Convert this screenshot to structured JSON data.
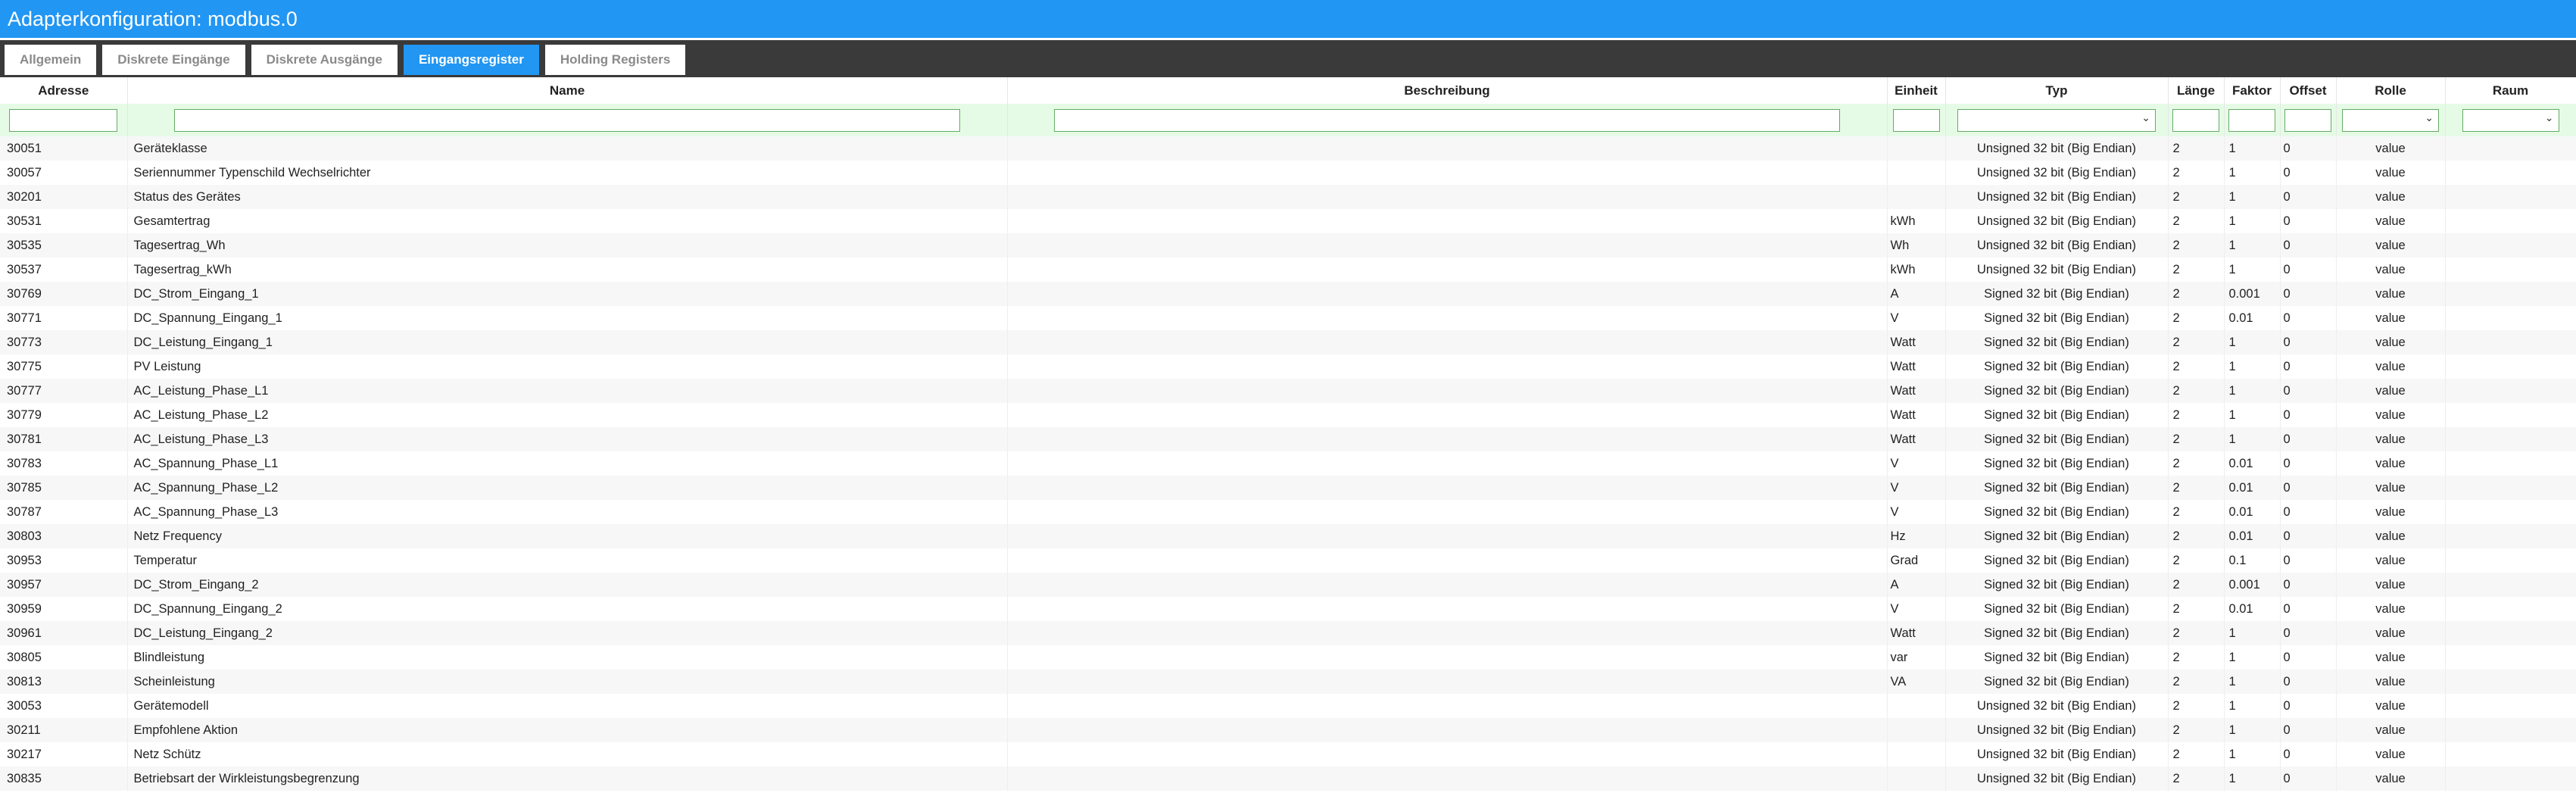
{
  "window": {
    "title": "Adapterkonfiguration: modbus.0"
  },
  "tabs": [
    {
      "label": "Allgemein",
      "active": false
    },
    {
      "label": "Diskrete Eingänge",
      "active": false
    },
    {
      "label": "Diskrete Ausgänge",
      "active": false
    },
    {
      "label": "Eingangsregister",
      "active": true
    },
    {
      "label": "Holding Registers",
      "active": false
    }
  ],
  "table": {
    "headers": {
      "address": "Adresse",
      "name": "Name",
      "description": "Beschreibung",
      "unit": "Einheit",
      "type": "Typ",
      "length": "Länge",
      "factor": "Faktor",
      "offset": "Offset",
      "role": "Rolle",
      "room": "Raum"
    },
    "rows": [
      {
        "address": "30051",
        "name": "Geräteklasse",
        "unit": "",
        "type": "Unsigned 32 bit (Big Endian)",
        "length": "2",
        "factor": "1",
        "offset": "0",
        "role": "value"
      },
      {
        "address": "30057",
        "name": "Seriennummer Typenschild Wechselrichter",
        "unit": "",
        "type": "Unsigned 32 bit (Big Endian)",
        "length": "2",
        "factor": "1",
        "offset": "0",
        "role": "value"
      },
      {
        "address": "30201",
        "name": "Status des Gerätes",
        "unit": "",
        "type": "Unsigned 32 bit (Big Endian)",
        "length": "2",
        "factor": "1",
        "offset": "0",
        "role": "value"
      },
      {
        "address": "30531",
        "name": "Gesamtertrag",
        "unit": "kWh",
        "type": "Unsigned 32 bit (Big Endian)",
        "length": "2",
        "factor": "1",
        "offset": "0",
        "role": "value"
      },
      {
        "address": "30535",
        "name": "Tagesertrag_Wh",
        "unit": "Wh",
        "type": "Unsigned 32 bit (Big Endian)",
        "length": "2",
        "factor": "1",
        "offset": "0",
        "role": "value"
      },
      {
        "address": "30537",
        "name": "Tagesertrag_kWh",
        "unit": "kWh",
        "type": "Unsigned 32 bit (Big Endian)",
        "length": "2",
        "factor": "1",
        "offset": "0",
        "role": "value"
      },
      {
        "address": "30769",
        "name": "DC_Strom_Eingang_1",
        "unit": "A",
        "type": "Signed 32 bit (Big Endian)",
        "length": "2",
        "factor": "0.001",
        "offset": "0",
        "role": "value"
      },
      {
        "address": "30771",
        "name": "DC_Spannung_Eingang_1",
        "unit": "V",
        "type": "Signed 32 bit (Big Endian)",
        "length": "2",
        "factor": "0.01",
        "offset": "0",
        "role": "value"
      },
      {
        "address": "30773",
        "name": "DC_Leistung_Eingang_1",
        "unit": "Watt",
        "type": "Signed 32 bit (Big Endian)",
        "length": "2",
        "factor": "1",
        "offset": "0",
        "role": "value"
      },
      {
        "address": "30775",
        "name": "PV Leistung",
        "unit": "Watt",
        "type": "Signed 32 bit (Big Endian)",
        "length": "2",
        "factor": "1",
        "offset": "0",
        "role": "value"
      },
      {
        "address": "30777",
        "name": "AC_Leistung_Phase_L1",
        "unit": "Watt",
        "type": "Signed 32 bit (Big Endian)",
        "length": "2",
        "factor": "1",
        "offset": "0",
        "role": "value"
      },
      {
        "address": "30779",
        "name": "AC_Leistung_Phase_L2",
        "unit": "Watt",
        "type": "Signed 32 bit (Big Endian)",
        "length": "2",
        "factor": "1",
        "offset": "0",
        "role": "value"
      },
      {
        "address": "30781",
        "name": "AC_Leistung_Phase_L3",
        "unit": "Watt",
        "type": "Signed 32 bit (Big Endian)",
        "length": "2",
        "factor": "1",
        "offset": "0",
        "role": "value"
      },
      {
        "address": "30783",
        "name": "AC_Spannung_Phase_L1",
        "unit": "V",
        "type": "Signed 32 bit (Big Endian)",
        "length": "2",
        "factor": "0.01",
        "offset": "0",
        "role": "value"
      },
      {
        "address": "30785",
        "name": "AC_Spannung_Phase_L2",
        "unit": "V",
        "type": "Signed 32 bit (Big Endian)",
        "length": "2",
        "factor": "0.01",
        "offset": "0",
        "role": "value"
      },
      {
        "address": "30787",
        "name": "AC_Spannung_Phase_L3",
        "unit": "V",
        "type": "Signed 32 bit (Big Endian)",
        "length": "2",
        "factor": "0.01",
        "offset": "0",
        "role": "value"
      },
      {
        "address": "30803",
        "name": "Netz Frequency",
        "unit": "Hz",
        "type": "Signed 32 bit (Big Endian)",
        "length": "2",
        "factor": "0.01",
        "offset": "0",
        "role": "value"
      },
      {
        "address": "30953",
        "name": "Temperatur",
        "unit": "Grad",
        "type": "Signed 32 bit (Big Endian)",
        "length": "2",
        "factor": "0.1",
        "offset": "0",
        "role": "value"
      },
      {
        "address": "30957",
        "name": "DC_Strom_Eingang_2",
        "unit": "A",
        "type": "Signed 32 bit (Big Endian)",
        "length": "2",
        "factor": "0.001",
        "offset": "0",
        "role": "value"
      },
      {
        "address": "30959",
        "name": "DC_Spannung_Eingang_2",
        "unit": "V",
        "type": "Signed 32 bit (Big Endian)",
        "length": "2",
        "factor": "0.01",
        "offset": "0",
        "role": "value"
      },
      {
        "address": "30961",
        "name": "DC_Leistung_Eingang_2",
        "unit": "Watt",
        "type": "Signed 32 bit (Big Endian)",
        "length": "2",
        "factor": "1",
        "offset": "0",
        "role": "value"
      },
      {
        "address": "30805",
        "name": "Blindleistung",
        "unit": "var",
        "type": "Signed 32 bit (Big Endian)",
        "length": "2",
        "factor": "1",
        "offset": "0",
        "role": "value"
      },
      {
        "address": "30813",
        "name": "Scheinleistung",
        "unit": "VA",
        "type": "Signed 32 bit (Big Endian)",
        "length": "2",
        "factor": "1",
        "offset": "0",
        "role": "value"
      },
      {
        "address": "30053",
        "name": "Gerätemodell",
        "unit": "",
        "type": "Unsigned 32 bit (Big Endian)",
        "length": "2",
        "factor": "1",
        "offset": "0",
        "role": "value"
      },
      {
        "address": "30211",
        "name": "Empfohlene Aktion",
        "unit": "",
        "type": "Unsigned 32 bit (Big Endian)",
        "length": "2",
        "factor": "1",
        "offset": "0",
        "role": "value"
      },
      {
        "address": "30217",
        "name": "Netz Schütz",
        "unit": "",
        "type": "Unsigned 32 bit (Big Endian)",
        "length": "2",
        "factor": "1",
        "offset": "0",
        "role": "value"
      },
      {
        "address": "30835",
        "name": "Betriebsart der Wirkleistungsbegrenzung",
        "unit": "",
        "type": "Unsigned 32 bit (Big Endian)",
        "length": "2",
        "factor": "1",
        "offset": "0",
        "role": "value"
      }
    ]
  },
  "icons": {
    "dropdown": "chevron-down-icon"
  }
}
